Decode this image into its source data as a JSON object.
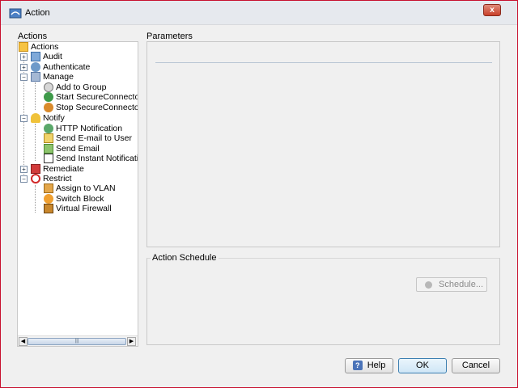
{
  "window": {
    "title": "Action",
    "close_label": "x"
  },
  "left_panel": {
    "label": "Actions"
  },
  "tree": {
    "root": "Actions",
    "audit": "Audit",
    "authenticate": "Authenticate",
    "manage": "Manage",
    "add_to_group": "Add to Group",
    "start_secureconnector": "Start SecureConnector",
    "stop_secureconnector": "Stop SecureConnector",
    "notify": "Notify",
    "http_notification": "HTTP Notification",
    "send_email_to_user": "Send E-mail to User",
    "send_email": "Send Email",
    "send_instant_notification": "Send Instant Notification",
    "remediate": "Remediate",
    "restrict": "Restrict",
    "assign_to_vlan": "Assign to VLAN",
    "switch_block": "Switch Block",
    "virtual_firewall": "Virtual Firewall",
    "expand_symbol": "+",
    "collapse_symbol": "−"
  },
  "scrollbar": {
    "left_arrow": "◀",
    "right_arrow": "▶",
    "grip": "|||"
  },
  "parameters": {
    "label": "Parameters"
  },
  "schedule": {
    "label": "Action Schedule",
    "button_label": "Schedule..."
  },
  "buttons": {
    "help": "Help",
    "help_icon": "?",
    "ok": "OK",
    "cancel": "Cancel"
  },
  "colors": {
    "window_border": "#c8102e",
    "background": "#f0f0f0"
  }
}
